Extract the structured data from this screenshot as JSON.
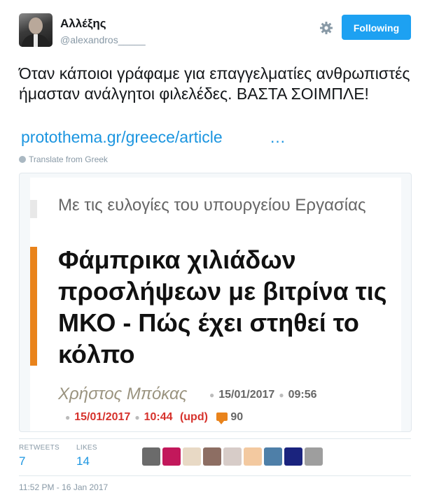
{
  "user": {
    "display_name": "Αλλέξης",
    "handle": "@alexandros_____"
  },
  "actions": {
    "follow_label": "Following"
  },
  "tweet": {
    "text": "Όταν κάποιοι γράφαμε για επαγγελματίες ανθρωπιστές ήμασταν ανάλγητοι φιλελέδες. ΒΑΣΤΑ ΣΟΙΜΠΛΕ!",
    "link": "protothema.gr/greece/article",
    "ellipsis": "…",
    "translate": "Translate from Greek",
    "timestamp": "11:52 PM - 16 Jan 2017"
  },
  "card": {
    "subtitle": "Με τις ευλογίες του υπουργείου Εργασίας",
    "headline": "Φάμπρικα χιλιάδων προσλήψεων με βιτρίνα τις ΜΚΟ - Πώς έχει στηθεί το κόλπο",
    "author": "Χρήστος Μπόκας",
    "date": "15/01/2017",
    "time": "09:56",
    "updated_date": "15/01/2017",
    "updated_time": "10:44",
    "updated_label": "(upd)",
    "comments": "90",
    "accent_color": "#e9831b",
    "update_color": "#d6322c"
  },
  "stats": {
    "retweets_label": "RETWEETS",
    "retweets": "7",
    "likes_label": "LIKES",
    "likes": "14"
  },
  "likers": [
    {
      "name": "liker-avatar",
      "color": "#6b6b6b"
    },
    {
      "name": "liker-avatar",
      "color": "#c2185b"
    },
    {
      "name": "liker-avatar",
      "color": "#e8d9c5"
    },
    {
      "name": "liker-avatar",
      "color": "#8d6e63"
    },
    {
      "name": "liker-avatar",
      "color": "#d7ccc8"
    },
    {
      "name": "liker-avatar",
      "color": "#f3c9a0"
    },
    {
      "name": "liker-avatar",
      "color": "#4e7fa8"
    },
    {
      "name": "liker-avatar",
      "color": "#1a237e"
    },
    {
      "name": "liker-avatar",
      "color": "#9e9e9e"
    }
  ],
  "colors": {
    "brand": "#1da1f2",
    "link": "#1b95e0",
    "muted": "#8899a6"
  },
  "icons": {
    "settings": "gear-icon",
    "translate": "globe-icon",
    "comments": "comment-bubble-icon"
  }
}
